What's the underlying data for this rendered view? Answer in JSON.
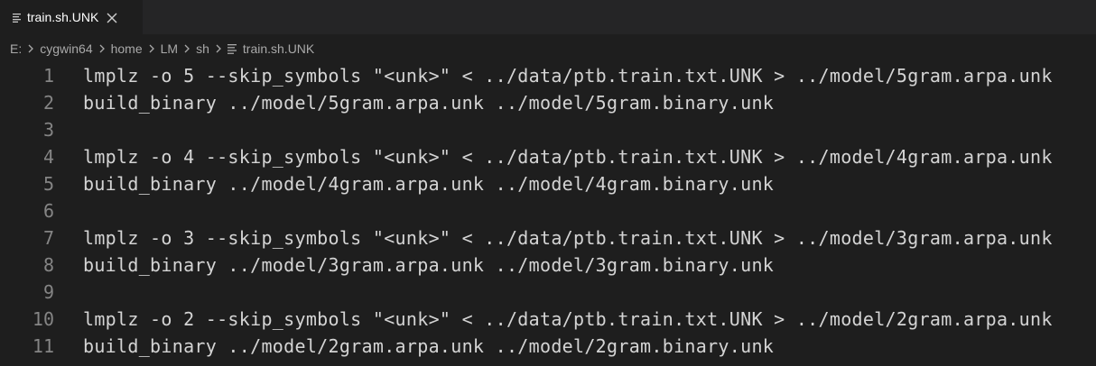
{
  "tab": {
    "title": "train.sh.UNK",
    "file_icon": "file-lines-icon",
    "close_icon": "close-icon"
  },
  "breadcrumb": {
    "items": [
      "E:",
      "cygwin64",
      "home",
      "LM",
      "sh"
    ],
    "file": "train.sh.UNK",
    "separator_icon": "chevron-right-icon"
  },
  "code": {
    "lines": [
      {
        "number": "1",
        "text": "lmplz -o 5 --skip_symbols \"<unk>\" < ../data/ptb.train.txt.UNK > ../model/5gram.arpa.unk"
      },
      {
        "number": "2",
        "text": "build_binary ../model/5gram.arpa.unk ../model/5gram.binary.unk"
      },
      {
        "number": "3",
        "text": ""
      },
      {
        "number": "4",
        "text": "lmplz -o 4 --skip_symbols \"<unk>\" < ../data/ptb.train.txt.UNK > ../model/4gram.arpa.unk"
      },
      {
        "number": "5",
        "text": "build_binary ../model/4gram.arpa.unk ../model/4gram.binary.unk"
      },
      {
        "number": "6",
        "text": ""
      },
      {
        "number": "7",
        "text": "lmplz -o 3 --skip_symbols \"<unk>\" < ../data/ptb.train.txt.UNK > ../model/3gram.arpa.unk"
      },
      {
        "number": "8",
        "text": "build_binary ../model/3gram.arpa.unk ../model/3gram.binary.unk"
      },
      {
        "number": "9",
        "text": ""
      },
      {
        "number": "10",
        "text": "lmplz -o 2 --skip_symbols \"<unk>\" < ../data/ptb.train.txt.UNK > ../model/2gram.arpa.unk"
      },
      {
        "number": "11",
        "text": "build_binary ../model/2gram.arpa.unk ../model/2gram.binary.unk"
      }
    ]
  },
  "colors": {
    "editor_background": "#1e1e1e",
    "tabbar_background": "#252526",
    "text": "#d4d4d4",
    "line_number": "#858585",
    "breadcrumb_text": "#a9a9a9"
  }
}
